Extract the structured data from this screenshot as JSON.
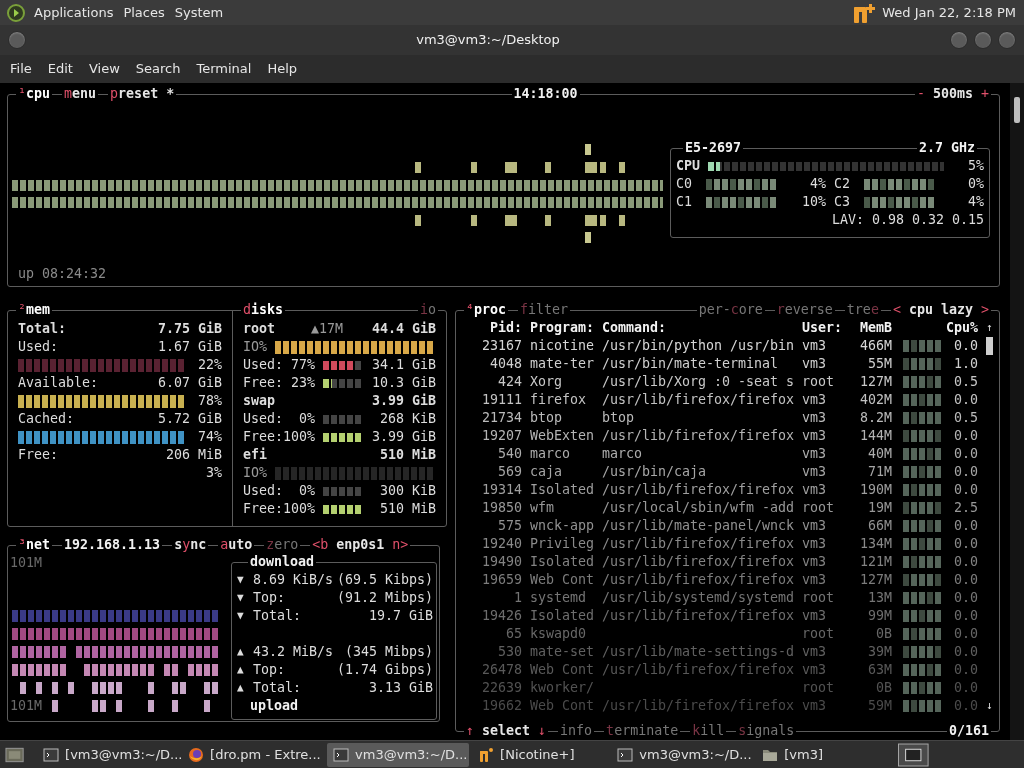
{
  "top_panel": {
    "menus": [
      "Applications",
      "Places",
      "System"
    ],
    "clock": "Wed Jan 22, 2:18 PM"
  },
  "window": {
    "title": "vm3@vm3:~/Desktop",
    "menu": [
      "File",
      "Edit",
      "View",
      "Search",
      "Terminal",
      "Help"
    ]
  },
  "cpu": {
    "header": {
      "left": [
        {
          "kind": "title",
          "dim": false,
          "segments": [
            {
              "text": "¹",
              "hot": true
            },
            {
              "text": "cpu",
              "hot": false
            }
          ]
        },
        {
          "kind": "toggle",
          "dim": false,
          "segments": [
            {
              "text": "m",
              "hot": true
            },
            {
              "text": "enu",
              "hot": false
            }
          ]
        },
        {
          "kind": "toggle",
          "dim": false,
          "segments": [
            {
              "text": "p",
              "hot": true
            },
            {
              "text": "reset *",
              "hot": false
            }
          ]
        }
      ],
      "center": [
        {
          "kind": "info",
          "dim": false,
          "segments": [
            {
              "text": "14:18:00",
              "hot": false
            }
          ]
        }
      ],
      "right": [
        {
          "kind": "toggle",
          "dim": false,
          "segments": [
            {
              "text": "-",
              "hot": true
            },
            {
              "text": " 500ms ",
              "hot": false
            },
            {
              "text": "+",
              "hot": true
            }
          ]
        }
      ]
    },
    "uptime": "up 08:24:32",
    "info": {
      "model": "E5-2697",
      "frequency": "2.7 GHz",
      "total": {
        "label": "CPU",
        "level": 0.05,
        "percent": "5%"
      },
      "cores": [
        {
          "label": "C0",
          "percent": "4%"
        },
        {
          "label": "C2",
          "percent": "0%"
        },
        {
          "label": "C1",
          "percent": "10%"
        },
        {
          "label": "C3",
          "percent": "4%"
        }
      ],
      "load": "LAV: 0.98 0.32 0.15"
    }
  },
  "mem": {
    "header": {
      "left": [
        {
          "kind": "title",
          "dim": false,
          "segments": [
            {
              "text": "²",
              "hot": true
            },
            {
              "text": "mem",
              "hot": false
            }
          ]
        }
      ]
    },
    "rows": [
      {
        "kind": "stat",
        "label": "Total:",
        "value": "7.75 GiB",
        "bold": true
      },
      {
        "kind": "stat",
        "label": "Used:",
        "value": "1.67 GiB",
        "bold": false
      },
      {
        "kind": "bar",
        "percent": "22%",
        "color": "#5a2232"
      },
      {
        "kind": "stat",
        "label": "Available:",
        "value": "6.07 GiB",
        "bold": false
      },
      {
        "kind": "bar",
        "percent": "78%",
        "color": "#c8b050"
      },
      {
        "kind": "stat",
        "label": "Cached:",
        "value": "5.72 GiB",
        "bold": false
      },
      {
        "kind": "bar",
        "percent": "74%",
        "color": "#3f92c4"
      },
      {
        "kind": "stat",
        "label": "Free:",
        "value": "206 MiB",
        "bold": false
      },
      {
        "kind": "bar",
        "percent": "3%"
      }
    ]
  },
  "disks": {
    "header": {
      "left": [
        {
          "kind": "title",
          "dim": false,
          "segments": [
            {
              "text": "d",
              "hot": true
            },
            {
              "text": "isks",
              "hot": false
            }
          ]
        }
      ],
      "right": [
        {
          "kind": "toggle",
          "dim": true,
          "segments": [
            {
              "text": "i",
              "hot": true
            },
            {
              "text": "o",
              "hot": false
            }
          ]
        }
      ]
    },
    "items": [
      {
        "name": "root",
        "io": "▲17M",
        "size": "44.4 GiB",
        "rows": [
          {
            "kind": "io",
            "label": "IO%",
            "level": 1.0
          },
          {
            "kind": "used",
            "label": "Used:",
            "percent": "77%",
            "level": 0.77,
            "value": "34.1 GiB"
          },
          {
            "kind": "free",
            "label": "Free:",
            "percent": "23%",
            "level": 0.23,
            "value": "10.3 GiB"
          }
        ]
      },
      {
        "name": "swap",
        "size": "3.99 GiB",
        "rows": [
          {
            "kind": "used",
            "label": "Used:",
            "percent": "0%",
            "level": 0.0,
            "value": "268 KiB"
          },
          {
            "kind": "free",
            "label": "Free:",
            "percent": "100%",
            "level": 1.0,
            "value": "3.99 GiB"
          }
        ]
      },
      {
        "name": "efi",
        "size": "510 MiB",
        "rows": [
          {
            "kind": "io",
            "label": "IO%",
            "level": 0.0
          },
          {
            "kind": "used",
            "label": "Used:",
            "percent": "0%",
            "level": 0.0,
            "value": "300 KiB"
          },
          {
            "kind": "free",
            "label": "Free:",
            "percent": "100%",
            "level": 1.0,
            "value": "510 MiB"
          }
        ]
      }
    ]
  },
  "net": {
    "header": {
      "left": [
        {
          "kind": "title",
          "dim": false,
          "segments": [
            {
              "text": "³",
              "hot": true
            },
            {
              "text": "net",
              "hot": false
            }
          ]
        },
        {
          "kind": "info",
          "dim": false,
          "segments": [
            {
              "text": "192.168.1.13",
              "hot": false
            }
          ]
        },
        {
          "kind": "toggle",
          "dim": false,
          "segments": [
            {
              "text": "s",
              "hot": false
            },
            {
              "text": "y",
              "hot": true
            },
            {
              "text": "nc",
              "hot": false
            }
          ]
        },
        {
          "kind": "toggle",
          "dim": false,
          "segments": [
            {
              "text": "a",
              "hot": true
            },
            {
              "text": "uto",
              "hot": false
            }
          ]
        },
        {
          "kind": "toggle",
          "dim": true,
          "segments": [
            {
              "text": "z",
              "hot": true
            },
            {
              "text": "ero",
              "hot": false
            }
          ]
        },
        {
          "kind": "toggle",
          "dim": false,
          "segments": [
            {
              "text": "<b",
              "hot": true
            },
            {
              "text": " enp0s1 ",
              "hot": false
            },
            {
              "text": "n>",
              "hot": true
            }
          ]
        }
      ]
    },
    "scale_top": "101M",
    "scale_bottom": "101M",
    "download_title": "download",
    "upload_title": "upload",
    "download": [
      {
        "arrow": "▼",
        "label": "8.69 KiB/s",
        "value": "(69.5 Kibps)"
      },
      {
        "arrow": "▼",
        "label": "Top:",
        "value": "(91.2 Mibps)"
      },
      {
        "arrow": "▼",
        "label": "Total:",
        "value": "19.7 GiB"
      }
    ],
    "upload": [
      {
        "arrow": "▲",
        "label": "43.2 MiB/s",
        "value": "(345 Mibps)"
      },
      {
        "arrow": "▲",
        "label": "Top:",
        "value": "(1.74 Gibps)"
      },
      {
        "arrow": "▲",
        "label": "Total:",
        "value": "3.13 GiB"
      }
    ]
  },
  "proc": {
    "header": {
      "left": [
        {
          "kind": "title",
          "dim": false,
          "segments": [
            {
              "text": "⁴",
              "hot": true
            },
            {
              "text": "proc",
              "hot": false
            }
          ]
        },
        {
          "kind": "toggle",
          "dim": true,
          "segments": [
            {
              "text": "f",
              "hot": true
            },
            {
              "text": "ilter",
              "hot": false
            }
          ]
        }
      ],
      "right": [
        {
          "kind": "toggle",
          "dim": true,
          "segments": [
            {
              "text": "per-",
              "hot": false
            },
            {
              "text": "c",
              "hot": true
            },
            {
              "text": "ore",
              "hot": false
            }
          ]
        },
        {
          "kind": "toggle",
          "dim": true,
          "segments": [
            {
              "text": "r",
              "hot": true
            },
            {
              "text": "everse",
              "hot": false
            }
          ]
        },
        {
          "kind": "toggle",
          "dim": true,
          "segments": [
            {
              "text": "tre",
              "hot": false
            },
            {
              "text": "e",
              "hot": true
            }
          ]
        },
        {
          "kind": "toggle",
          "dim": false,
          "segments": [
            {
              "text": "<",
              "hot": true
            },
            {
              "text": " cpu lazy ",
              "hot": false
            },
            {
              "text": ">",
              "hot": true
            }
          ]
        }
      ]
    },
    "columns": [
      "Pid:",
      "Program:",
      "Command:",
      "User:",
      "MemB",
      "Cpu%"
    ],
    "scroll_up": "↑",
    "scroll_down": "↓",
    "rows": [
      {
        "pid": "23167",
        "program": "nicotine",
        "command": "/usr/bin/python /usr/bin",
        "user": "vm3",
        "memb": "466M",
        "cpu": "0.0"
      },
      {
        "pid": "4048",
        "program": "mate-ter",
        "command": "/usr/bin/mate-terminal",
        "user": "vm3",
        "memb": "55M",
        "cpu": "1.0"
      },
      {
        "pid": "424",
        "program": "Xorg",
        "command": "/usr/lib/Xorg :0 -seat s",
        "user": "root",
        "memb": "127M",
        "cpu": "0.5"
      },
      {
        "pid": "19111",
        "program": "firefox",
        "command": "/usr/lib/firefox/firefox",
        "user": "vm3",
        "memb": "402M",
        "cpu": "0.0"
      },
      {
        "pid": "21734",
        "program": "btop",
        "command": "btop",
        "user": "vm3",
        "memb": "8.2M",
        "cpu": "0.5"
      },
      {
        "pid": "19207",
        "program": "WebExten",
        "command": "/usr/lib/firefox/firefox",
        "user": "vm3",
        "memb": "144M",
        "cpu": "0.0"
      },
      {
        "pid": "540",
        "program": "marco",
        "command": "marco",
        "user": "vm3",
        "memb": "40M",
        "cpu": "0.0"
      },
      {
        "pid": "569",
        "program": "caja",
        "command": "/usr/bin/caja",
        "user": "vm3",
        "memb": "71M",
        "cpu": "0.0"
      },
      {
        "pid": "19314",
        "program": "Isolated",
        "command": "/usr/lib/firefox/firefox",
        "user": "vm3",
        "memb": "190M",
        "cpu": "0.0"
      },
      {
        "pid": "19850",
        "program": "wfm",
        "command": "/usr/local/sbin/wfm -add",
        "user": "root",
        "memb": "19M",
        "cpu": "2.5"
      },
      {
        "pid": "575",
        "program": "wnck-app",
        "command": "/usr/lib/mate-panel/wnck",
        "user": "vm3",
        "memb": "66M",
        "cpu": "0.0"
      },
      {
        "pid": "19240",
        "program": "Privileg",
        "command": "/usr/lib/firefox/firefox",
        "user": "vm3",
        "memb": "134M",
        "cpu": "0.0"
      },
      {
        "pid": "19490",
        "program": "Isolated",
        "command": "/usr/lib/firefox/firefox",
        "user": "vm3",
        "memb": "121M",
        "cpu": "0.0"
      },
      {
        "pid": "19659",
        "program": "Web Cont",
        "command": "/usr/lib/firefox/firefox",
        "user": "vm3",
        "memb": "127M",
        "cpu": "0.0"
      },
      {
        "pid": "1",
        "program": "systemd",
        "command": "/usr/lib/systemd/systemd",
        "user": "root",
        "memb": "13M",
        "cpu": "0.0"
      },
      {
        "pid": "19426",
        "program": "Isolated",
        "command": "/usr/lib/firefox/firefox",
        "user": "vm3",
        "memb": "99M",
        "cpu": "0.0"
      },
      {
        "pid": "65",
        "program": "kswapd0",
        "user": "root",
        "memb": "0B",
        "cpu": "0.0"
      },
      {
        "pid": "530",
        "program": "mate-set",
        "command": "/usr/lib/mate-settings-d",
        "user": "vm3",
        "memb": "39M",
        "cpu": "0.0"
      },
      {
        "pid": "26478",
        "program": "Web Cont",
        "command": "/usr/lib/firefox/firefox",
        "user": "vm3",
        "memb": "63M",
        "cpu": "0.0"
      },
      {
        "pid": "22639",
        "program": "kworker/",
        "user": "root",
        "memb": "0B",
        "cpu": "0.0"
      },
      {
        "pid": "19662",
        "program": "Web Cont",
        "command": "/usr/lib/firefox/firefox",
        "user": "vm3",
        "memb": "59M",
        "cpu": "0.0"
      }
    ],
    "footer": {
      "left": [
        {
          "kind": "toggle",
          "dim": false,
          "segments": [
            {
              "text": "↑",
              "hot": true
            },
            {
              "text": " select ",
              "hot": false
            },
            {
              "text": "↓",
              "hot": true
            }
          ]
        },
        {
          "kind": "toggle",
          "dim": true,
          "segments": [
            {
              "text": "info",
              "hot": false
            }
          ]
        },
        {
          "kind": "toggle",
          "dim": true,
          "segments": [
            {
              "text": "t",
              "hot": true
            },
            {
              "text": "erminate",
              "hot": false
            }
          ]
        },
        {
          "kind": "toggle",
          "dim": true,
          "segments": [
            {
              "text": "k",
              "hot": true
            },
            {
              "text": "ill",
              "hot": false
            }
          ]
        },
        {
          "kind": "toggle",
          "dim": true,
          "segments": [
            {
              "text": "s",
              "hot": true
            },
            {
              "text": "ignals",
              "hot": false
            }
          ]
        }
      ],
      "right": [
        {
          "kind": "info",
          "dim": false,
          "segments": [
            {
              "text": "0/161",
              "hot": false
            }
          ]
        }
      ]
    }
  },
  "taskbar": [
    {
      "kind": "terminal",
      "title": "[vm3@vm3:~/D...",
      "selected": false
    },
    {
      "kind": "browser",
      "title": "[dro.pm - Extre...",
      "selected": false
    },
    {
      "kind": "terminal",
      "title": "vm3@vm3:~/D...",
      "selected": true
    },
    {
      "kind": "nicotine",
      "title": "[Nicotine+]",
      "selected": false
    },
    {
      "kind": "terminal",
      "title": "vm3@vm3:~/D...",
      "selected": false
    },
    {
      "kind": "folder",
      "title": "[vm3]",
      "selected": false
    }
  ]
}
